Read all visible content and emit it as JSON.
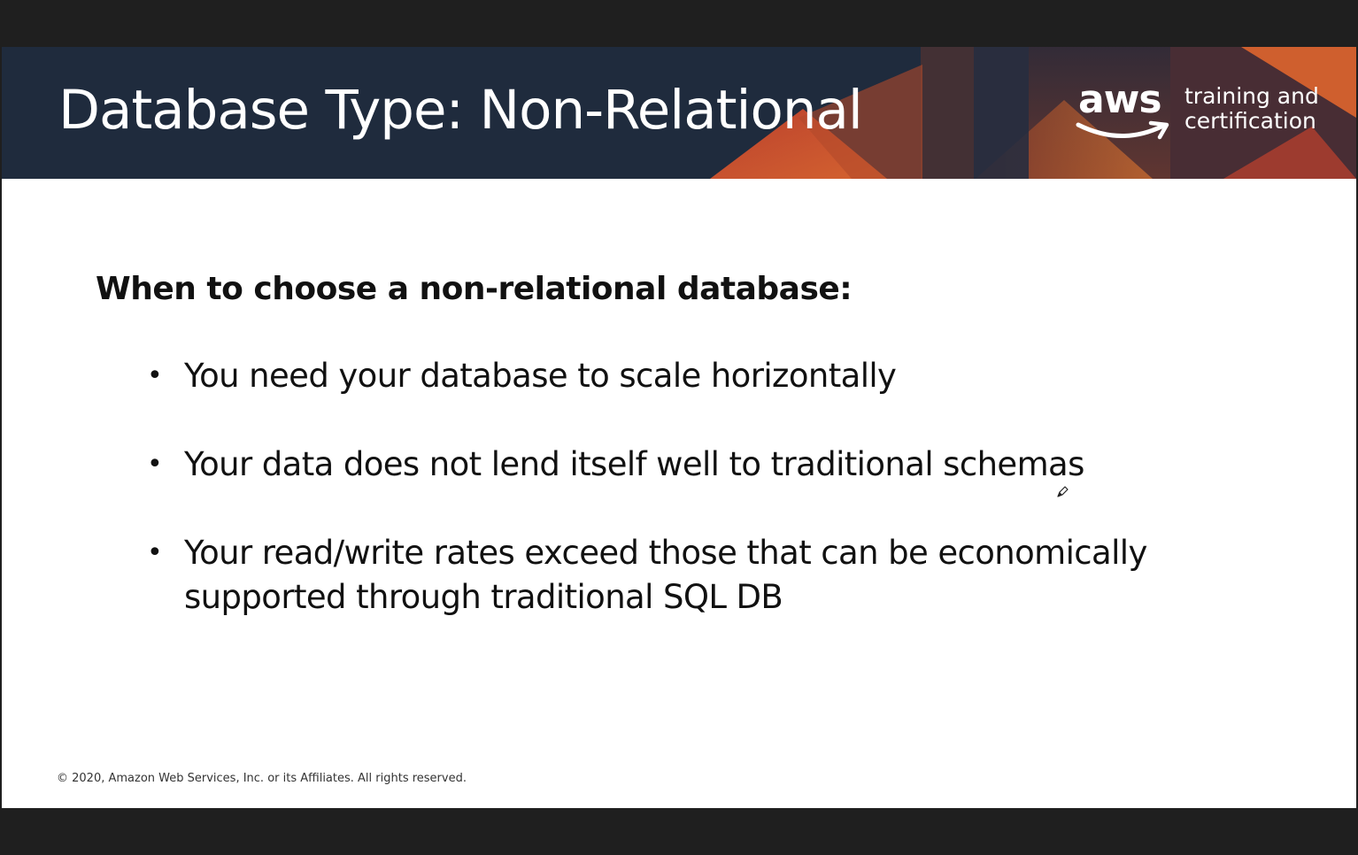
{
  "slide": {
    "title": "Database Type: Non-Relational",
    "logo": {
      "word": "aws",
      "tagline_line1": "training and",
      "tagline_line2": "certification"
    },
    "subheading": "When to choose a non-relational database:",
    "bullets": [
      "You need your database to scale horizontally",
      "Your data does not lend itself well to traditional schemas",
      "Your read/write rates exceed those that can be economically supported through traditional SQL DB"
    ],
    "footer": "© 2020, Amazon Web Services, Inc. or its Affiliates. All rights reserved.",
    "colors": {
      "header_bg": "#1f2b3d",
      "accent_orange": "#e8692e",
      "accent_red": "#c2412d",
      "letterbox": "#1f1f1f"
    }
  }
}
